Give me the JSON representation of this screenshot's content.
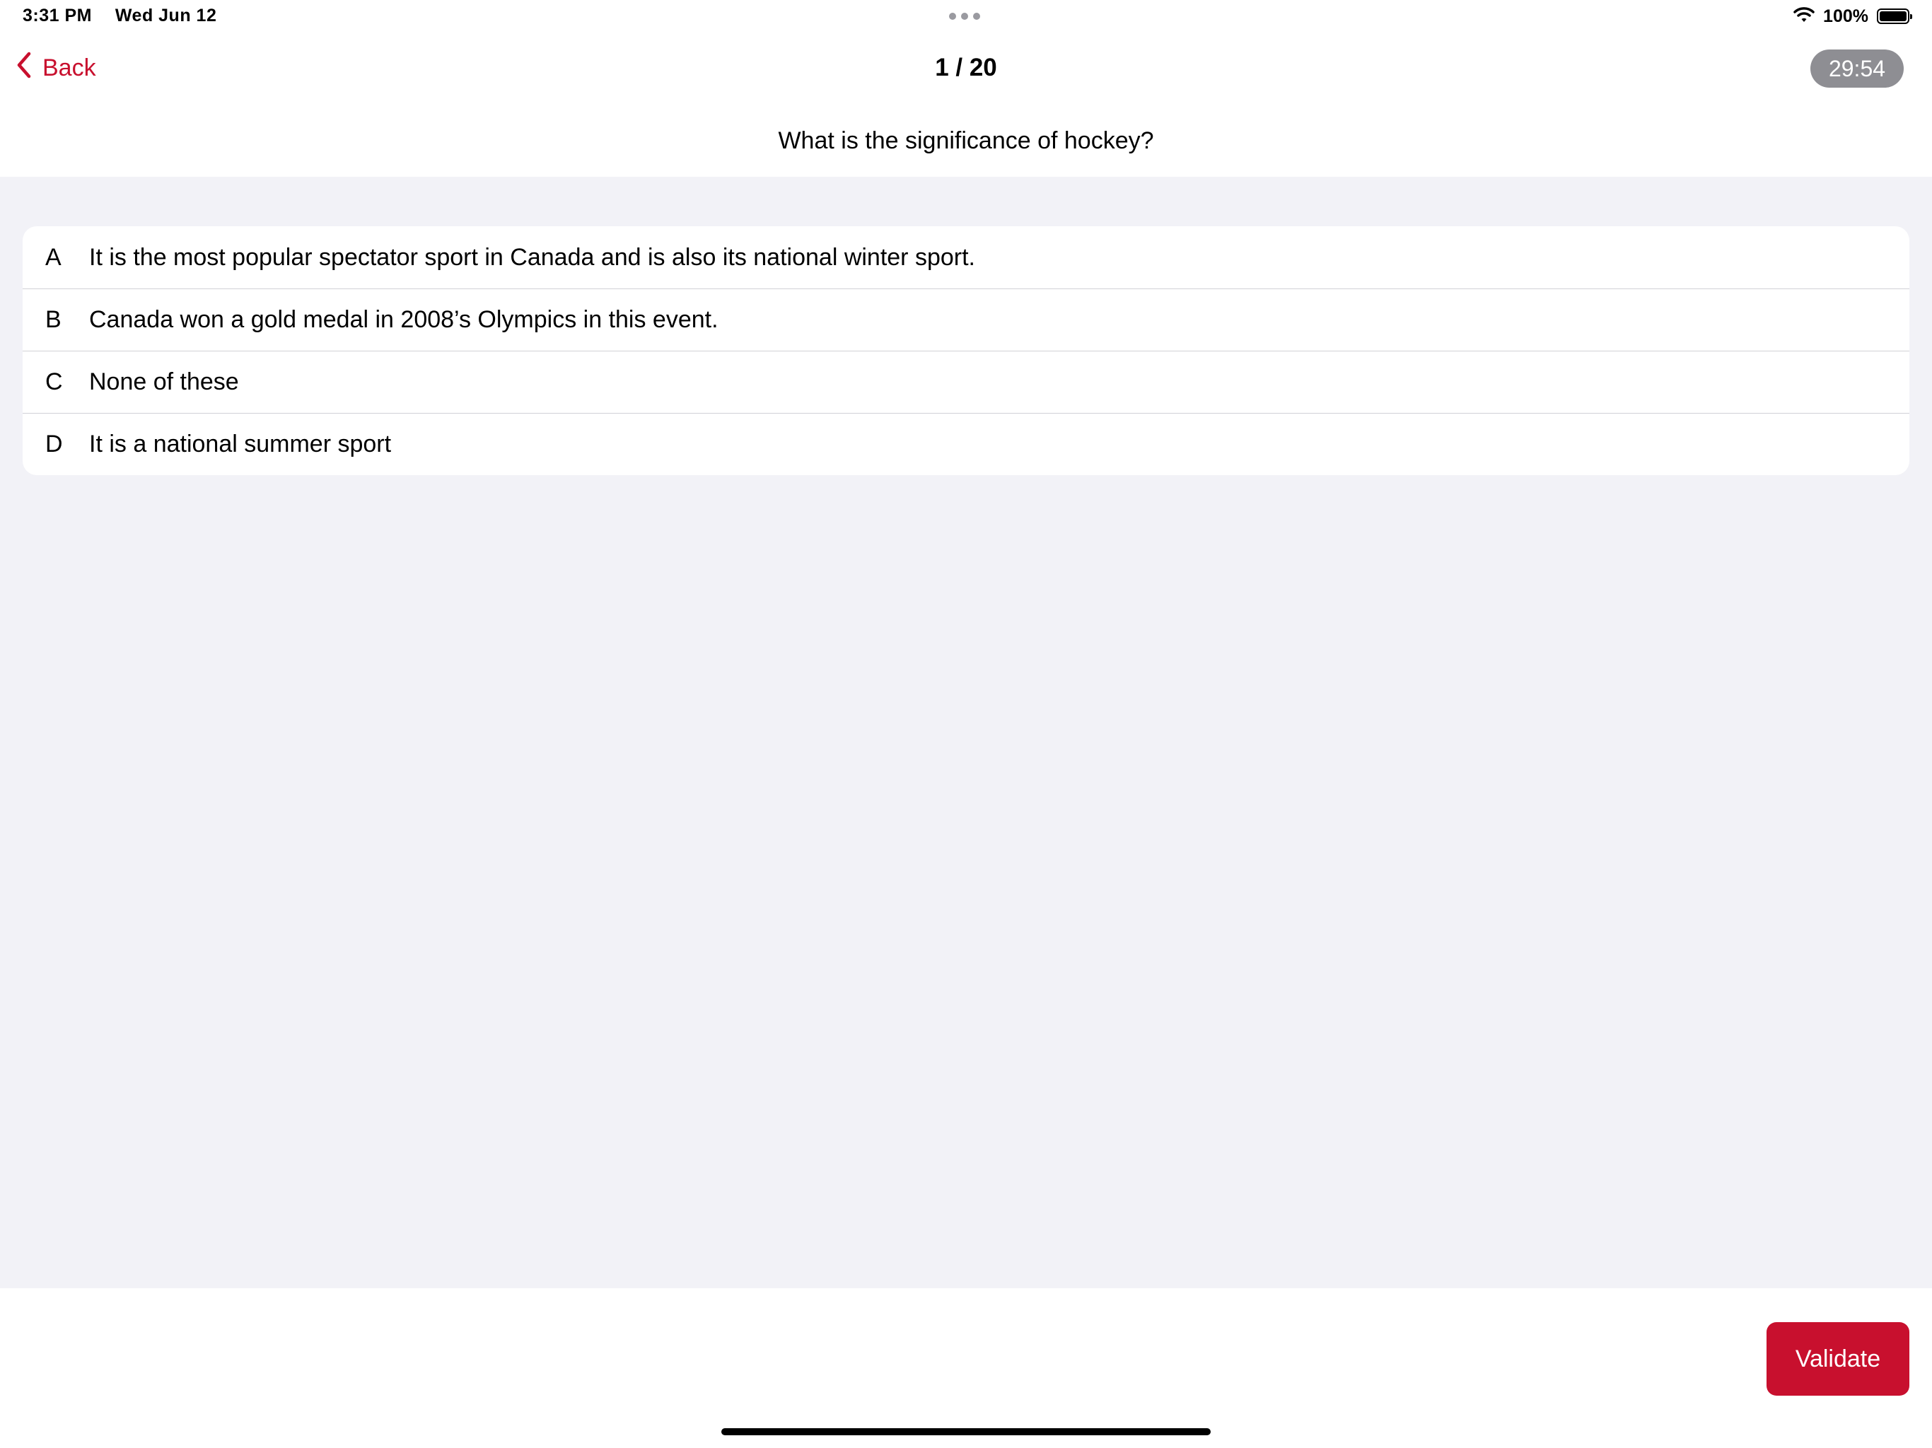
{
  "status_bar": {
    "time": "3:31 PM",
    "date": "Wed Jun 12",
    "battery_percent": "100%",
    "battery_level": 1.0,
    "icons": [
      "multitasking-dots-icon",
      "wifi-icon",
      "battery-icon"
    ]
  },
  "nav": {
    "back_label": "Back",
    "counter": "1 / 20",
    "timer": "29:54"
  },
  "question": {
    "text": "What is the significance of hockey?"
  },
  "answers": [
    {
      "letter": "A",
      "text": "It is the most popular spectator sport in Canada and is also its national winter sport."
    },
    {
      "letter": "B",
      "text": "Canada won a gold medal in 2008’s Olympics in this event."
    },
    {
      "letter": "C",
      "text": "None of these"
    },
    {
      "letter": "D",
      "text": "It is a national summer sport"
    }
  ],
  "footer": {
    "validate_label": "Validate"
  },
  "colors": {
    "accent": "#c8102e",
    "background_grey": "#f2f2f7",
    "timer_badge": "#8e8e93"
  }
}
